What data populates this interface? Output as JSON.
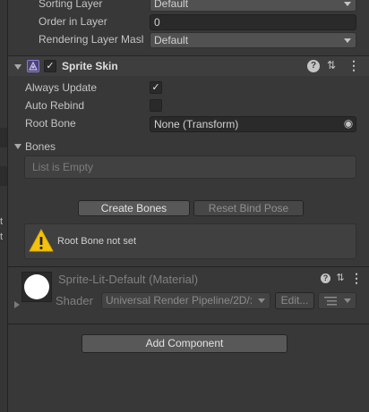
{
  "left_strip": {
    "fragment_1": "t",
    "fragment_2": "t"
  },
  "renderer": {
    "sorting_layer": {
      "label": "Sorting Layer",
      "value": "Default"
    },
    "order_in_layer": {
      "label": "Order in Layer",
      "value": "0"
    },
    "rendering_layer_mask": {
      "label": "Rendering Layer Masl",
      "value": "Default"
    }
  },
  "sprite_skin": {
    "title": "Sprite Skin",
    "enabled": true,
    "always_update": {
      "label": "Always Update",
      "checked": true,
      "mark": "✓"
    },
    "auto_rebind": {
      "label": "Auto Rebind",
      "checked": false
    },
    "root_bone": {
      "label": "Root Bone",
      "value": "None (Transform)"
    },
    "bones": {
      "label": "Bones",
      "empty_text": "List is Empty"
    },
    "create_bones_button": "Create Bones",
    "reset_bind_pose_button": "Reset Bind Pose",
    "warning": {
      "icon": "warning-icon",
      "text": "Root Bone not set"
    }
  },
  "material": {
    "name": "Sprite-Lit-Default (Material)",
    "shader_label": "Shader",
    "shader_value": "Universal Render Pipeline/2D/:",
    "edit_button": "Edit..."
  },
  "add_component_button": "Add Component",
  "icons": {
    "help": "?",
    "settings": "⇅",
    "more": "⋮",
    "enabled_check": "✓",
    "warning": "!",
    "object_picker": "◉"
  },
  "colors": {
    "background": "#383838",
    "field": "#2a2a2a",
    "button": "#585858",
    "warning_yellow": "#f4c20d"
  }
}
